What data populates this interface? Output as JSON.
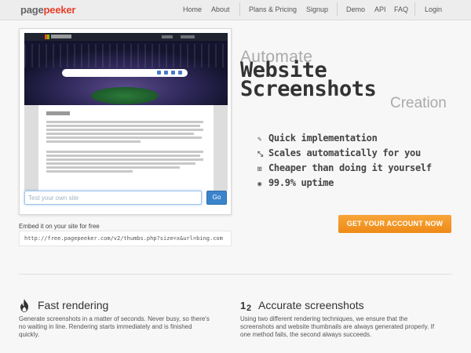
{
  "nav": {
    "logo_part1": "page",
    "logo_part2": "peeker",
    "links": {
      "home": "Home",
      "about": "About",
      "plans": "Plans & Pricing",
      "signup": "Signup",
      "demo": "Demo",
      "api": "API",
      "faq": "FAQ",
      "login": "Login"
    }
  },
  "preview": {
    "screenshot_alt": "Microsoft Bing homepage screenshot with consent dialog",
    "try_placeholder": "Test your own site",
    "go_label": "Go"
  },
  "hero": {
    "line1": "Automate",
    "line2": "Website",
    "line3": "Screenshots",
    "line4": "Creation"
  },
  "features": [
    {
      "icon": "pencil-icon",
      "glyph": "✎",
      "label": "Quick implementation"
    },
    {
      "icon": "arrows-icon",
      "glyph": "⤡",
      "label": "Scales automatically for you"
    },
    {
      "icon": "grid-icon",
      "glyph": "⊞",
      "label": "Cheaper than doing it yourself"
    },
    {
      "icon": "gauge-icon",
      "glyph": "◉",
      "label": "99.9% uptime"
    }
  ],
  "cta": {
    "label": "GET YOUR ACCOUNT NOW"
  },
  "embed": {
    "label": "Embed it on your site for free",
    "url": "http://free.pagepeeker.com/v2/thumbs.php?size=x&url=bing.com"
  },
  "bottom": {
    "fast": {
      "title": "Fast rendering",
      "text_line1": "Generate screenshots in a matter of seconds. Never busy, so there's",
      "text_line2": "no waiting in line. Rendering starts immediately and is finished",
      "text_line3": "quickly."
    },
    "accurate": {
      "title": "Accurate screenshots",
      "text_line1": "Using two different rendering techniques, we ensure that the",
      "text_line2": "screenshots and website thumbnails are always generated properly. If",
      "text_line3": "one method fails, the second always succeeds."
    }
  },
  "colors": {
    "brand_red": "#e8402c",
    "cta_orange": "#f39c28",
    "go_blue": "#3a84cc"
  }
}
